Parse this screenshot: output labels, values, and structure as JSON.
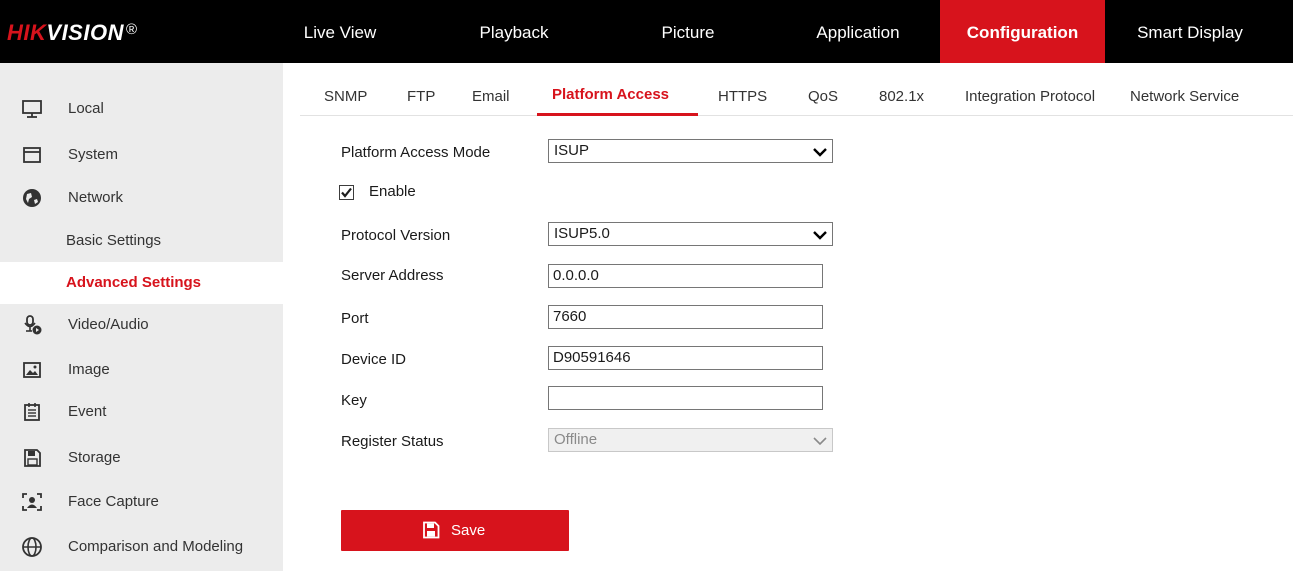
{
  "brand": {
    "logo_red": "HIK",
    "logo_white": "VISION",
    "logo_mark": "®"
  },
  "nav": {
    "items": [
      "Live View",
      "Playback",
      "Picture",
      "Application",
      "Configuration",
      "Smart Display"
    ],
    "active": "Configuration"
  },
  "sidebar": {
    "items": [
      {
        "label": "Local",
        "icon": "monitor-icon"
      },
      {
        "label": "System",
        "icon": "window-icon"
      },
      {
        "label": "Network",
        "icon": "globe-icon"
      },
      {
        "label": "Basic Settings"
      },
      {
        "label": "Advanced Settings",
        "active": true
      },
      {
        "label": "Video/Audio",
        "icon": "microphone-camera-icon"
      },
      {
        "label": "Image",
        "icon": "image-icon"
      },
      {
        "label": "Event",
        "icon": "calendar-icon"
      },
      {
        "label": "Storage",
        "icon": "floppy-icon"
      },
      {
        "label": "Face Capture",
        "icon": "face-frame-icon"
      },
      {
        "label": "Comparison and Modeling",
        "icon": "comparison-icon"
      }
    ]
  },
  "tabs": {
    "items": [
      "SNMP",
      "FTP",
      "Email",
      "Platform Access",
      "HTTPS",
      "QoS",
      "802.1x",
      "Integration Protocol",
      "Network Service"
    ],
    "active": "Platform Access"
  },
  "form": {
    "platform_access_mode": {
      "label": "Platform Access Mode",
      "value": "ISUP"
    },
    "enable": {
      "label": "Enable",
      "checked": true
    },
    "protocol_version": {
      "label": "Protocol Version",
      "value": "ISUP5.0"
    },
    "server_address": {
      "label": "Server Address",
      "value": "0.0.0.0"
    },
    "port": {
      "label": "Port",
      "value": "7660"
    },
    "device_id": {
      "label": "Device ID",
      "value": "D90591646"
    },
    "key": {
      "label": "Key",
      "value": ""
    },
    "register_status": {
      "label": "Register Status",
      "value": "Offline"
    }
  },
  "actions": {
    "save_label": "Save"
  },
  "colors": {
    "accent": "#d7131c",
    "topbar": "#000000",
    "sidebar": "#ececec"
  }
}
